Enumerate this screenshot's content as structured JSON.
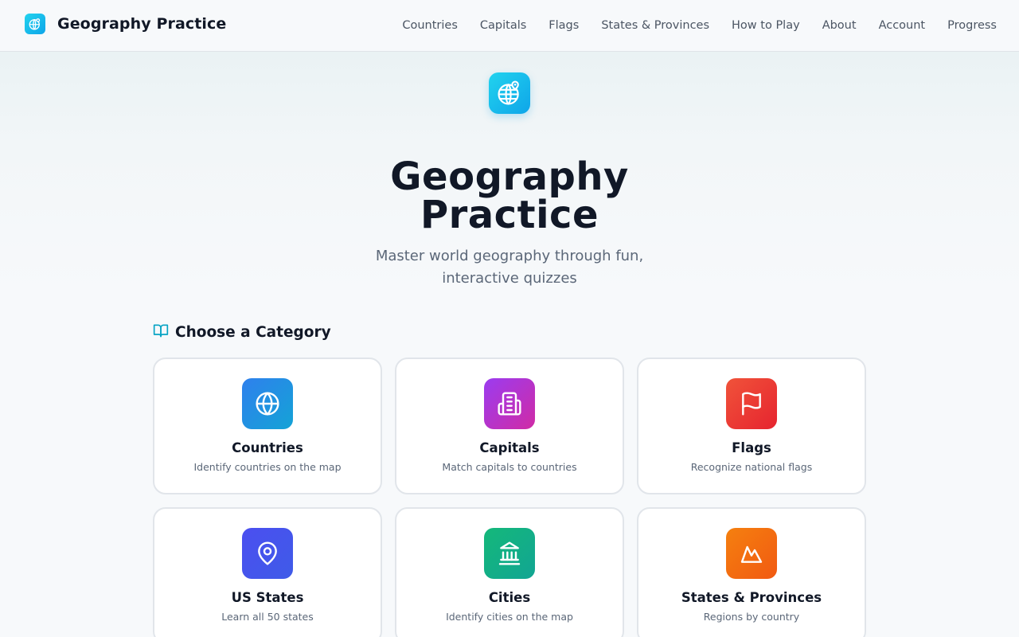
{
  "header": {
    "title": "Geography Practice",
    "logo_icon": "globe-pin-icon",
    "nav": [
      {
        "label": "Countries"
      },
      {
        "label": "Capitals"
      },
      {
        "label": "Flags"
      },
      {
        "label": "States & Provinces"
      },
      {
        "label": "How to Play"
      },
      {
        "label": "About"
      },
      {
        "label": "Account"
      },
      {
        "label": "Progress"
      }
    ]
  },
  "hero": {
    "icon": "globe-pin-icon",
    "title_line1": "Geography",
    "title_line2": "Practice",
    "subtitle_line1": "Master world geography through fun,",
    "subtitle_line2": "interactive quizzes"
  },
  "section": {
    "icon": "book-open-icon",
    "title": "Choose a Category"
  },
  "categories": [
    {
      "title": "Countries",
      "description": "Identify countries on the map",
      "icon": "globe-icon",
      "gradient": [
        "#2f80ed",
        "#14a3d6"
      ]
    },
    {
      "title": "Capitals",
      "description": "Match capitals to countries",
      "icon": "building-icon",
      "gradient": [
        "#9b3cf0",
        "#d02ba5"
      ]
    },
    {
      "title": "Flags",
      "description": "Recognize national flags",
      "icon": "flag-icon",
      "gradient": [
        "#f0533a",
        "#e6242f"
      ]
    },
    {
      "title": "US States",
      "description": "Learn all 50 states",
      "icon": "map-pin-icon",
      "gradient": [
        "#4b4ff0",
        "#3f5be8"
      ]
    },
    {
      "title": "Cities",
      "description": "Identify cities on the map",
      "icon": "landmark-icon",
      "gradient": [
        "#14b87a",
        "#12a593"
      ]
    },
    {
      "title": "States & Provinces",
      "description": "Regions by country",
      "icon": "mountain-icon",
      "gradient": [
        "#f5800f",
        "#f15a12"
      ]
    }
  ],
  "colors": {
    "accent": "#0ea5e9",
    "section_icon": "#06a3c4"
  }
}
